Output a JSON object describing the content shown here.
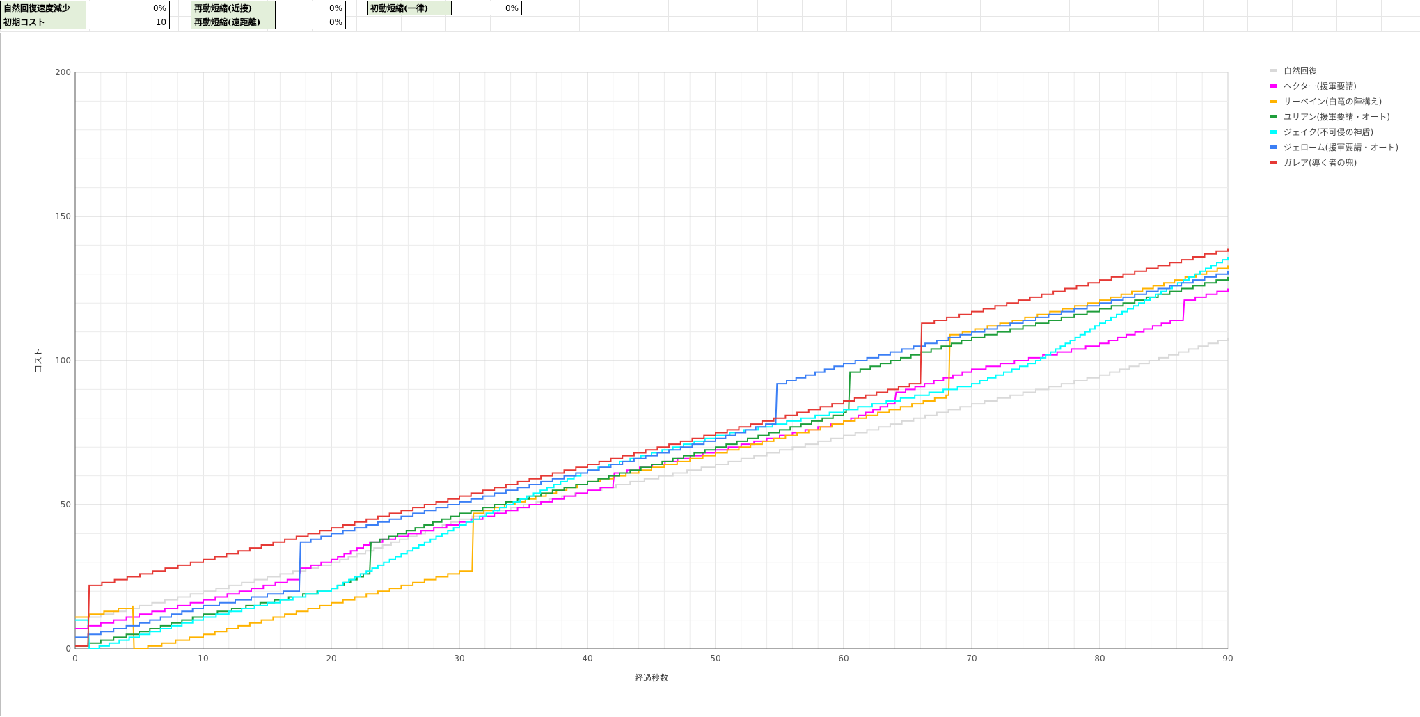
{
  "params": {
    "natural_recovery_reduction": {
      "label": "自然回復速度減少",
      "value": "0%"
    },
    "initial_cost": {
      "label": "初期コスト",
      "value": "10"
    },
    "redeploy_melee": {
      "label": "再動短縮(近接)",
      "value": "0%"
    },
    "redeploy_ranged": {
      "label": "再動短縮(遠距離)",
      "value": "0%"
    },
    "initial_reduction": {
      "label": "初動短縮(一律)",
      "value": "0%"
    }
  },
  "chart_data": {
    "type": "line",
    "step": true,
    "title": "",
    "xlabel": "経過秒数",
    "ylabel": "コスト",
    "xlim": [
      0,
      90
    ],
    "ylim": [
      0,
      200
    ],
    "xticks": [
      0,
      10,
      20,
      30,
      40,
      50,
      60,
      70,
      80,
      90
    ],
    "yticks": [
      0,
      50,
      100,
      150,
      200
    ],
    "grid": true,
    "legend_position": "right",
    "series": [
      {
        "name": "自然回復",
        "color": "#d9d9d9",
        "points": [
          [
            0,
            10
          ],
          [
            5,
            15
          ],
          [
            10,
            20
          ],
          [
            20,
            30
          ],
          [
            30,
            45
          ],
          [
            40,
            55
          ],
          [
            50,
            64
          ],
          [
            60,
            74
          ],
          [
            70,
            85
          ],
          [
            80,
            95
          ],
          [
            90,
            108
          ]
        ]
      },
      {
        "name": "ヘクター(援軍要請)",
        "color": "#ff00ff",
        "points": [
          [
            0,
            7
          ],
          [
            1,
            8
          ],
          [
            5,
            12
          ],
          [
            10,
            17
          ],
          [
            17.5,
            25
          ],
          [
            17.6,
            28
          ],
          [
            20,
            31
          ],
          [
            23,
            37
          ],
          [
            30,
            44
          ],
          [
            40,
            55
          ],
          [
            42,
            57
          ],
          [
            42.1,
            61
          ],
          [
            50,
            69
          ],
          [
            60,
            79
          ],
          [
            64,
            86
          ],
          [
            64.1,
            89
          ],
          [
            70,
            97
          ],
          [
            80,
            106
          ],
          [
            85.5,
            114
          ],
          [
            86.5,
            114
          ],
          [
            86.6,
            121
          ],
          [
            90,
            125
          ]
        ]
      },
      {
        "name": "サーベイン(白竜の陣構え)",
        "color": "#ffb300",
        "points": [
          [
            0,
            11
          ],
          [
            4.5,
            15
          ],
          [
            4.6,
            0
          ],
          [
            10,
            5
          ],
          [
            20,
            16
          ],
          [
            30,
            27
          ],
          [
            31,
            28
          ],
          [
            31.1,
            47
          ],
          [
            40,
            58
          ],
          [
            50,
            68
          ],
          [
            60,
            79
          ],
          [
            68,
            88
          ],
          [
            68.2,
            88
          ],
          [
            68.3,
            109
          ],
          [
            80,
            121
          ],
          [
            90,
            133
          ]
        ]
      },
      {
        "name": "ユリアン(援軍要請・オート)",
        "color": "#1f9e3b",
        "points": [
          [
            0,
            1
          ],
          [
            5,
            6
          ],
          [
            10,
            12
          ],
          [
            20,
            21
          ],
          [
            23,
            27
          ],
          [
            23.1,
            37
          ],
          [
            30,
            47
          ],
          [
            40,
            58
          ],
          [
            50,
            70
          ],
          [
            60,
            82
          ],
          [
            60.4,
            84
          ],
          [
            60.5,
            96
          ],
          [
            70,
            108
          ],
          [
            80,
            118
          ],
          [
            90,
            129
          ]
        ]
      },
      {
        "name": "ジェイク(不可侵の神盾)",
        "color": "#00ffff",
        "points": [
          [
            0,
            10
          ],
          [
            1,
            10
          ],
          [
            1.1,
            0
          ],
          [
            5,
            5
          ],
          [
            10,
            11
          ],
          [
            20,
            21
          ],
          [
            30,
            43
          ],
          [
            40,
            62
          ],
          [
            50,
            74
          ],
          [
            60,
            83
          ],
          [
            70,
            92
          ],
          [
            75,
            100
          ],
          [
            80,
            113
          ],
          [
            90,
            136
          ]
        ]
      },
      {
        "name": "ジェローム(援軍要請・オート)",
        "color": "#3b7ff5",
        "points": [
          [
            0,
            4
          ],
          [
            5,
            9
          ],
          [
            10,
            15
          ],
          [
            17.5,
            21
          ],
          [
            17.6,
            37
          ],
          [
            20,
            40
          ],
          [
            30,
            51
          ],
          [
            40,
            62
          ],
          [
            50,
            73
          ],
          [
            54.7,
            79
          ],
          [
            54.8,
            92
          ],
          [
            60,
            99
          ],
          [
            70,
            110
          ],
          [
            80,
            120
          ],
          [
            90,
            131
          ]
        ]
      },
      {
        "name": "ガレア(導く者の兜)",
        "color": "#e53935",
        "points": [
          [
            0,
            1
          ],
          [
            1,
            1
          ],
          [
            1.1,
            22
          ],
          [
            10,
            31
          ],
          [
            20,
            42
          ],
          [
            30,
            53
          ],
          [
            40,
            64
          ],
          [
            50,
            75
          ],
          [
            60,
            86
          ],
          [
            66,
            93
          ],
          [
            66.1,
            113
          ],
          [
            70,
            117
          ],
          [
            80,
            128
          ],
          [
            90,
            139
          ]
        ]
      }
    ]
  }
}
